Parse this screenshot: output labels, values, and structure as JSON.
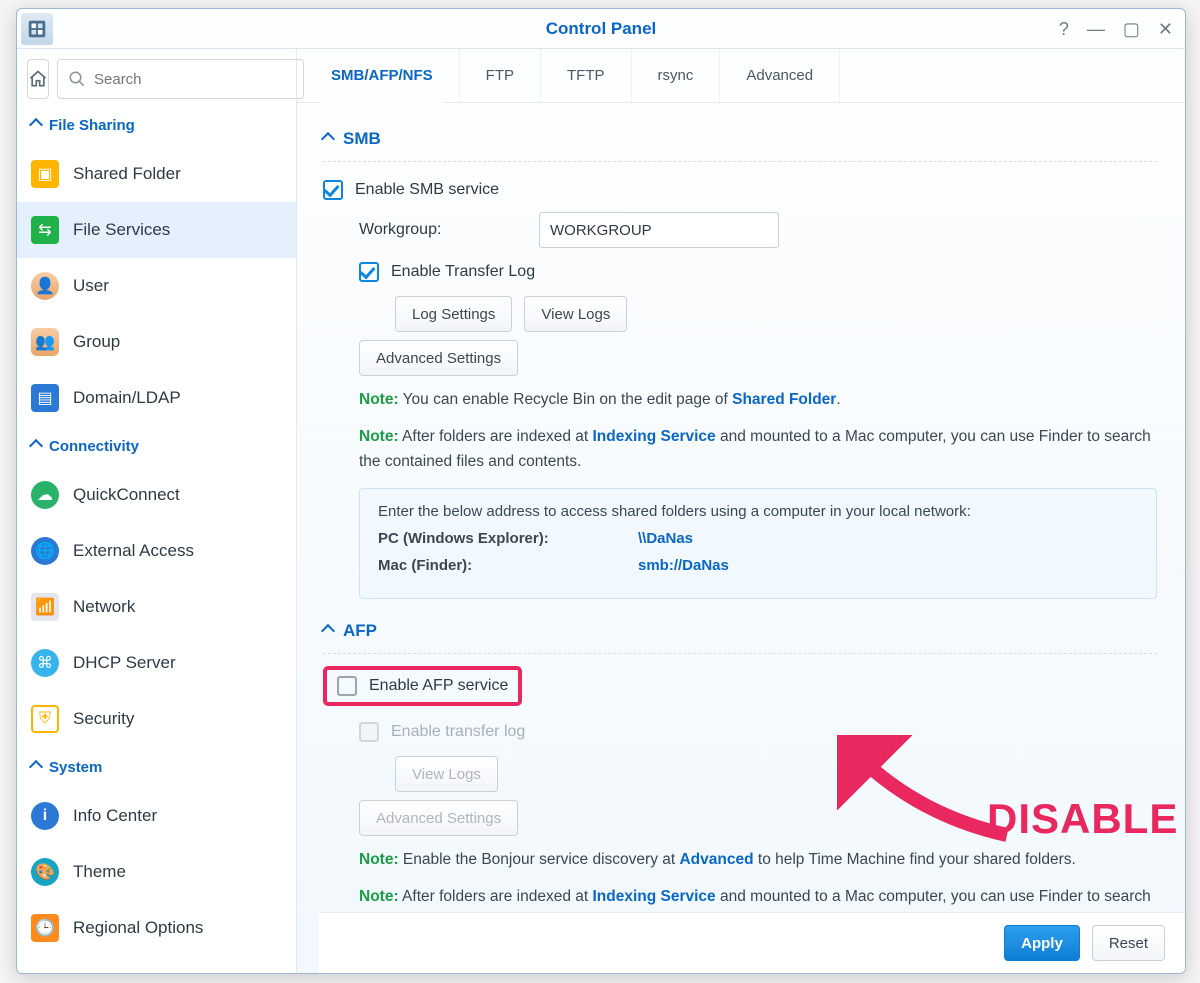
{
  "window": {
    "title": "Control Panel"
  },
  "search": {
    "placeholder": "Search"
  },
  "sidebar": {
    "sections": {
      "fileSharing": "File Sharing",
      "connectivity": "Connectivity",
      "system": "System"
    },
    "items": {
      "sharedFolder": "Shared Folder",
      "fileServices": "File Services",
      "user": "User",
      "group": "Group",
      "domainLdap": "Domain/LDAP",
      "quickConnect": "QuickConnect",
      "externalAccess": "External Access",
      "network": "Network",
      "dhcpServer": "DHCP Server",
      "security": "Security",
      "infoCenter": "Info Center",
      "theme": "Theme",
      "regionalOptions": "Regional Options"
    }
  },
  "tabs": {
    "smbafpnfs": "SMB/AFP/NFS",
    "ftp": "FTP",
    "tftp": "TFTP",
    "rsync": "rsync",
    "advanced": "Advanced"
  },
  "smb": {
    "heading": "SMB",
    "enable": "Enable SMB service",
    "workgroupLabel": "Workgroup:",
    "workgroupValue": "WORKGROUP",
    "enableTransferLog": "Enable Transfer Log",
    "logSettings": "Log Settings",
    "viewLogs": "View Logs",
    "advancedSettings": "Advanced Settings",
    "note1_pre": " You can enable Recycle Bin on the edit page of ",
    "note1_link": "Shared Folder",
    "note2_pre": " After folders are indexed at ",
    "note2_link": "Indexing Service",
    "note2_post": " and mounted to a Mac computer, you can use Finder to search the contained files and contents.",
    "access_intro": "Enter the below address to access shared folders using a computer in your local network:",
    "pcLabel": "PC (Windows Explorer):",
    "pcPath": "\\\\DaNas",
    "macLabel": "Mac (Finder):",
    "macPath": "smb://DaNas"
  },
  "afp": {
    "heading": "AFP",
    "enable": "Enable AFP service",
    "enableTransferLog": "Enable transfer log",
    "viewLogs": "View Logs",
    "advancedSettings": "Advanced Settings",
    "note1_pre": " Enable the Bonjour service discovery at ",
    "note1_link": "Advanced",
    "note1_post": " to help Time Machine find your shared folders.",
    "note2_pre": " After folders are indexed at ",
    "note2_link": "Indexing Service",
    "note2_post": " and mounted to a Mac computer, you can use Finder to search the contained files and contents."
  },
  "labels": {
    "note": "Note:"
  },
  "footer": {
    "apply": "Apply",
    "reset": "Reset"
  },
  "annotation": "DISABLE IT!!"
}
